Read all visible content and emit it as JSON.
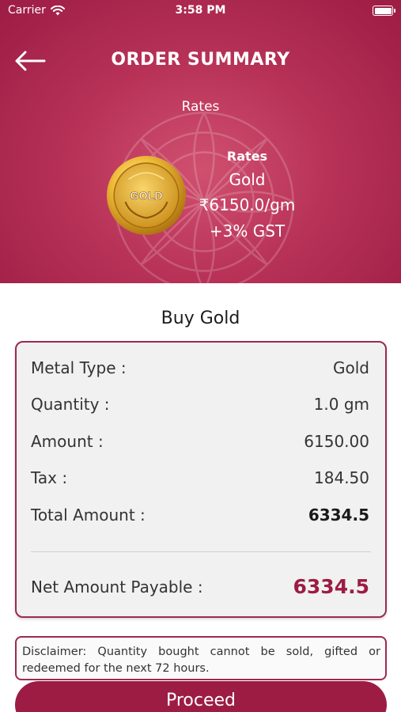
{
  "status_bar": {
    "carrier": "Carrier",
    "time": "3:58 PM"
  },
  "header": {
    "title": "ORDER SUMMARY",
    "subtitle": "Rates"
  },
  "rate_card": {
    "coin_text": "GOLD",
    "label": "Rates",
    "metal": "Gold",
    "price": "₹6150.0/gm",
    "gst": "+3% GST"
  },
  "summary": {
    "heading": "Buy Gold",
    "rows": [
      {
        "label": "Metal Type :",
        "value": "Gold"
      },
      {
        "label": "Quantity :",
        "value": "1.0 gm"
      },
      {
        "label": "Amount :",
        "value": "6150.00"
      },
      {
        "label": "Tax :",
        "value": "184.50"
      },
      {
        "label": "Total Amount :",
        "value": "6334.5"
      }
    ],
    "net_label": "Net Amount Payable :",
    "net_value": "6334.5"
  },
  "disclaimer": "Disclaimer: Quantity bought cannot be sold, gifted or redeemed for the next 72 hours.",
  "proceed_label": "Proceed",
  "colors": {
    "brand": "#9c1c44",
    "hero_light": "#d0506f",
    "gold": "#e0a528"
  },
  "icons": {
    "back": "arrow-left-icon",
    "wifi": "wifi-icon",
    "battery": "battery-icon"
  }
}
